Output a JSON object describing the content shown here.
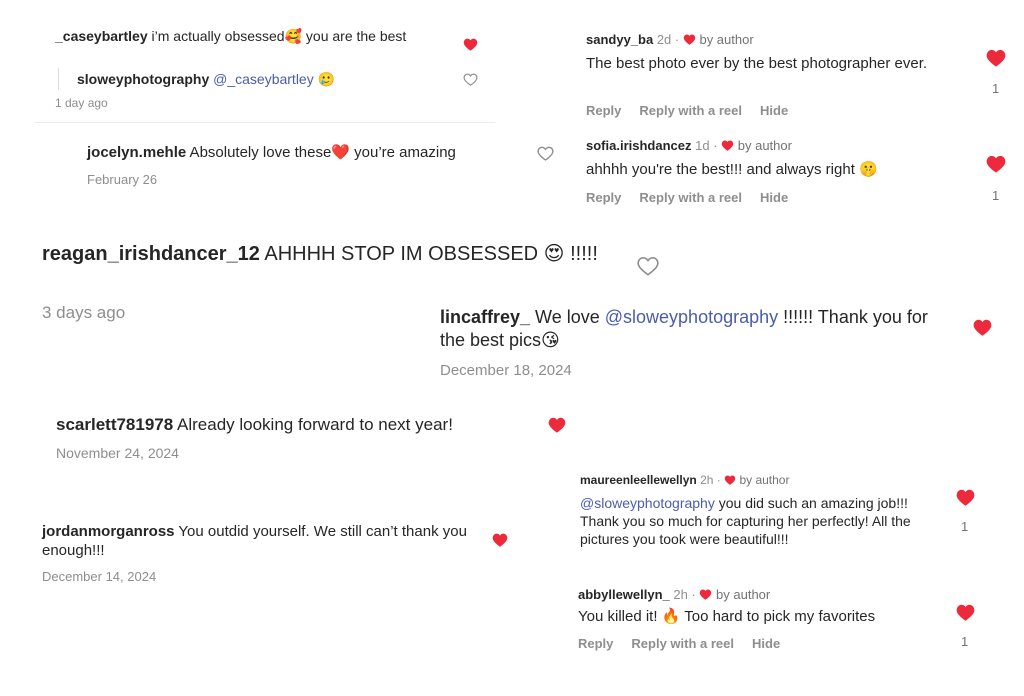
{
  "colors": {
    "heart_red": "#ed2a3c",
    "mention": "#4a5dab",
    "muted": "#8e8e8e"
  },
  "icons": {
    "filled_heart": "heart-filled-icon",
    "outline_heart": "heart-outline-icon"
  },
  "c1": {
    "user": "_caseybartley",
    "text": " i’m actually obsessed🥰  you are the best",
    "reply": {
      "user": "sloweyphotography",
      "mention": "@_caseybartley",
      "emoji": " 🥲"
    },
    "time": "1 day ago"
  },
  "c2": {
    "user": "jocelyn.mehle",
    "text": " Absolutely love these❤️ you’re amazing",
    "time": "February 26"
  },
  "c3": {
    "user": "sandyy_ba",
    "time": "2d · ",
    "author": "by author",
    "text": "The best photo ever by the best photographer ever.",
    "count": "1",
    "actions": [
      "Reply",
      "Reply with a reel",
      "Hide"
    ]
  },
  "c4": {
    "user": "sofia.irishdancez",
    "time": "1d · ",
    "author": "by author",
    "text": "ahhhh you're the best!!! and always right 🤫",
    "count": "1",
    "actions": [
      "Reply",
      "Reply with a reel",
      "Hide"
    ]
  },
  "c5": {
    "user": "reagan_irishdancer_12",
    "text": " AHHHH STOP IM OBSESSED 😍 !!!!!",
    "time": "3 days ago"
  },
  "c6": {
    "user": "lincaffrey_",
    "text_a": " We love ",
    "mention": "@sloweyphotography",
    "text_b": " !!!!!! Thank you for the best pics😘",
    "time": "December 18, 2024"
  },
  "c7": {
    "user": "scarlett781978",
    "text": " Already looking forward to next year!",
    "time": "November 24, 2024"
  },
  "c8": {
    "user": "jordanmorganross",
    "text": " You outdid yourself. We still can’t thank you enough!!!",
    "time": "December 14, 2024"
  },
  "c9": {
    "user": "maureenleellewellyn",
    "time": "2h · ",
    "author": "by author",
    "mention": "@sloweyphotography",
    "text": " you did such an amazing job!!! Thank you so much for capturing her perfectly! All the pictures you took were beautiful!!!",
    "count": "1"
  },
  "c10": {
    "user": "abbyllewellyn_",
    "time": "2h · ",
    "author": "by author",
    "text": "You killed it! 🔥 Too hard to pick my favorites",
    "count": "1",
    "actions": [
      "Reply",
      "Reply with a reel",
      "Hide"
    ]
  }
}
